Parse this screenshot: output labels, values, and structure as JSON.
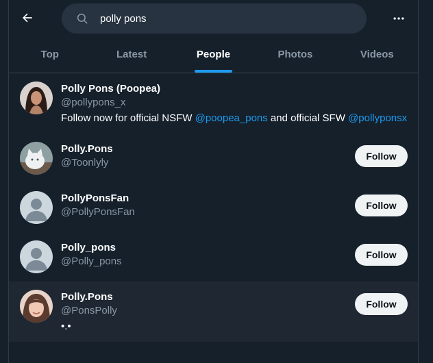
{
  "header": {
    "back_icon": "arrow-left-icon",
    "search": {
      "value": "polly pons",
      "icon": "search-icon"
    },
    "more_icon": "more-horizontal-icon"
  },
  "tabs": [
    {
      "label": "Top",
      "active": false
    },
    {
      "label": "Latest",
      "active": false
    },
    {
      "label": "People",
      "active": true
    },
    {
      "label": "Photos",
      "active": false
    },
    {
      "label": "Videos",
      "active": false
    }
  ],
  "colors": {
    "accent": "#1d9bf0",
    "background": "#15202b",
    "muted": "#8b98a5",
    "button": "#eff3f4"
  },
  "users": [
    {
      "name": "Polly Pons (Poopea)",
      "handle": "@pollypons_x",
      "bio": {
        "t1": "Follow now for official NSFW ",
        "l1": "@poopea_pons",
        "t2": " and official SFW ",
        "l2": "@pollyponsx"
      },
      "avatar": "portrait-photo"
    },
    {
      "name": "Polly.Pons",
      "handle": "@Toonlyly",
      "follow_label": "Follow",
      "avatar": "white-cat-photo"
    },
    {
      "name": "PollyPonsFan",
      "handle": "@PollyPonsFan",
      "follow_label": "Follow",
      "avatar": "default-avatar"
    },
    {
      "name": "Polly_pons",
      "handle": "@Polly_pons",
      "follow_label": "Follow",
      "avatar": "default-avatar"
    },
    {
      "name": "Polly.Pons",
      "handle": "@PonsPolly",
      "bio": "•.•",
      "follow_label": "Follow",
      "avatar": "selfie-photo"
    }
  ]
}
